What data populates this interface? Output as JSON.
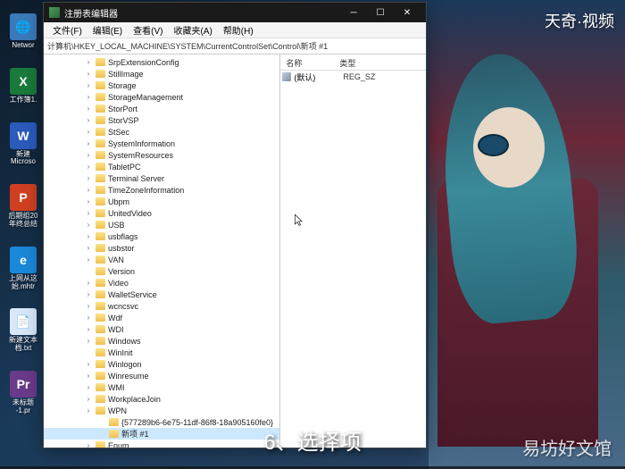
{
  "desktop_icons": [
    {
      "label": "Networ",
      "color": "#3a7aba",
      "glyph": "🌐"
    },
    {
      "label": "工作簿1.",
      "color": "#1a7a3a",
      "glyph": "X"
    },
    {
      "label": "新建\nMicroso",
      "color": "#2a5aba",
      "glyph": "W"
    },
    {
      "label": "后期组20\n年终总结",
      "color": "#d04020",
      "glyph": "P"
    },
    {
      "label": "上网从这\n始.mhtr",
      "color": "#1a88d8",
      "glyph": "e"
    },
    {
      "label": "新建文本\n档.txt",
      "color": "#d8e8f8",
      "glyph": "📄"
    },
    {
      "label": "未标题\n-1.pr",
      "color": "#6a3a8a",
      "glyph": "Pr"
    }
  ],
  "window": {
    "title": "注册表编辑器",
    "menu": [
      "文件(F)",
      "编辑(E)",
      "查看(V)",
      "收藏夹(A)",
      "帮助(H)"
    ],
    "address": "计算机\\HKEY_LOCAL_MACHINE\\SYSTEM\\CurrentControlSet\\Control\\新项 #1",
    "tree_items": [
      {
        "name": "SrpExtensionConfig",
        "expandable": true
      },
      {
        "name": "StillImage",
        "expandable": true
      },
      {
        "name": "Storage",
        "expandable": true
      },
      {
        "name": "StorageManagement",
        "expandable": true
      },
      {
        "name": "StorPort",
        "expandable": true
      },
      {
        "name": "StorVSP",
        "expandable": true
      },
      {
        "name": "StSec",
        "expandable": true
      },
      {
        "name": "SystemInformation",
        "expandable": true
      },
      {
        "name": "SystemResources",
        "expandable": true
      },
      {
        "name": "TabletPC",
        "expandable": true
      },
      {
        "name": "Terminal Server",
        "expandable": true
      },
      {
        "name": "TimeZoneInformation",
        "expandable": true
      },
      {
        "name": "Ubpm",
        "expandable": true
      },
      {
        "name": "UnitedVideo",
        "expandable": true
      },
      {
        "name": "USB",
        "expandable": true
      },
      {
        "name": "usbflags",
        "expandable": true
      },
      {
        "name": "usbstor",
        "expandable": true
      },
      {
        "name": "VAN",
        "expandable": true
      },
      {
        "name": "Version",
        "expandable": false
      },
      {
        "name": "Video",
        "expandable": true
      },
      {
        "name": "WalletService",
        "expandable": true
      },
      {
        "name": "wcncsvc",
        "expandable": true
      },
      {
        "name": "Wdf",
        "expandable": true
      },
      {
        "name": "WDI",
        "expandable": true
      },
      {
        "name": "Windows",
        "expandable": true
      },
      {
        "name": "WinInit",
        "expandable": false
      },
      {
        "name": "Winlogon",
        "expandable": true
      },
      {
        "name": "Winresume",
        "expandable": true
      },
      {
        "name": "WMI",
        "expandable": true
      },
      {
        "name": "WorkplaceJoin",
        "expandable": true
      },
      {
        "name": "WPN",
        "expandable": true
      }
    ],
    "guid_item": "{577289b6-6e75-11df-86f8-18a905160fe0}",
    "selected_item": "新项 #1",
    "enum_item": "Enum",
    "values_header": {
      "name": "名称",
      "type": "类型"
    },
    "values": [
      {
        "name": "(默认)",
        "type": "REG_SZ"
      }
    ]
  },
  "watermarks": {
    "top_right": "天奇·视频",
    "bottom_right": "易坊好文馆"
  },
  "caption": "6、选择项"
}
